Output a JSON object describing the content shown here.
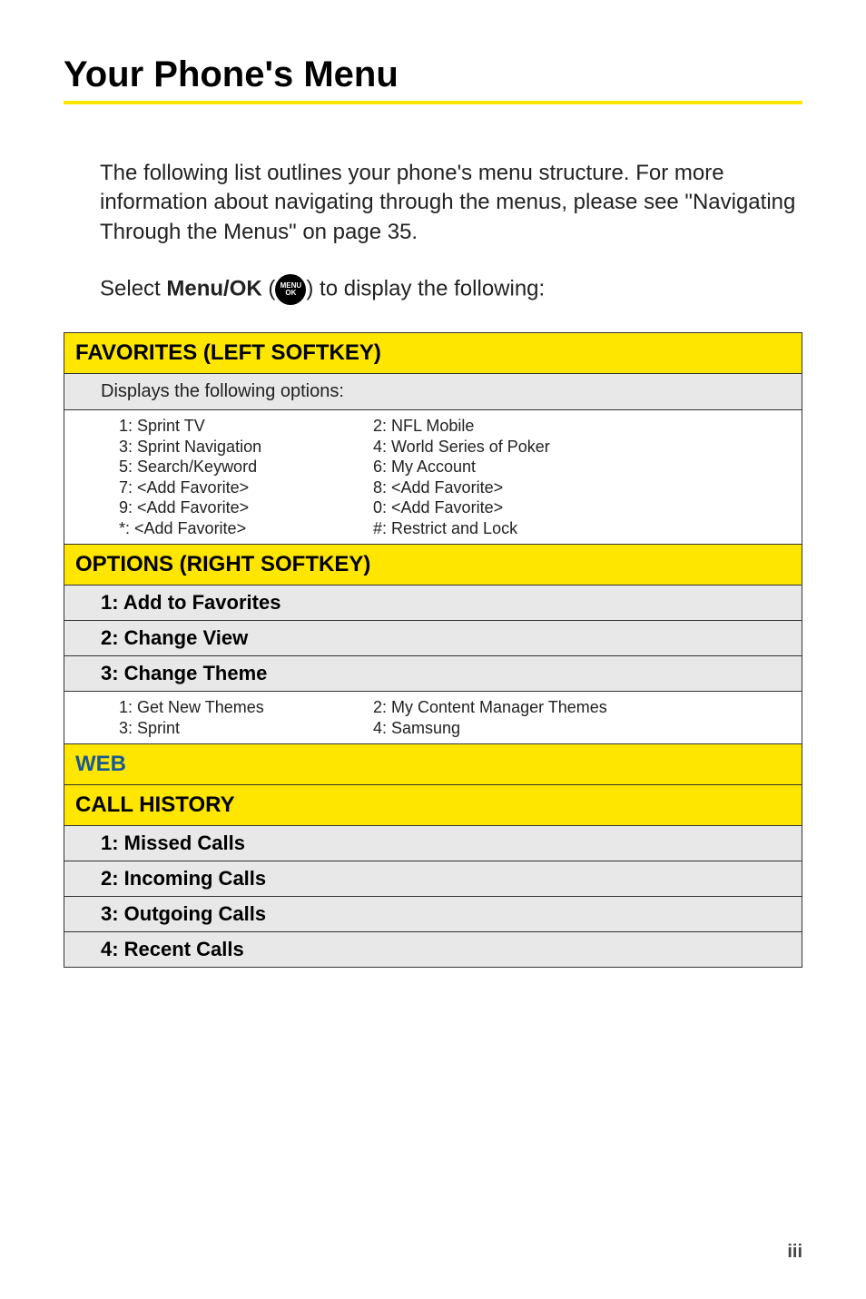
{
  "title": "Your Phone's Menu",
  "intro": "The following list outlines your phone's menu structure. For more information about navigating through the menus, please see \"Navigating Through the Menus\" on page 35.",
  "select_prefix": "Select ",
  "select_bold": "Menu/OK",
  "select_paren_open": " (",
  "icon_top": "MENU",
  "icon_bottom": "OK",
  "select_paren_close": ") ",
  "select_suffix": "to display the following:",
  "sections": {
    "favorites": {
      "header": "FAVORITES (LEFT SOFTKEY)",
      "desc": "Displays the following options:",
      "col1": [
        "1: Sprint TV",
        "3: Sprint Navigation",
        "5: Search/Keyword",
        "7: <Add Favorite>",
        "9: <Add Favorite>",
        "*: <Add Favorite>"
      ],
      "col2": [
        "2: NFL Mobile",
        "4: World Series of Poker",
        "6: My Account",
        "8: <Add Favorite>",
        "0: <Add Favorite>",
        "#: Restrict and Lock"
      ]
    },
    "options": {
      "header": "OPTIONS (RIGHT SOFTKEY)",
      "items": [
        "1: Add to Favorites",
        "2: Change View",
        "3: Change Theme"
      ],
      "themes_col1": [
        "1: Get New Themes",
        "3: Sprint"
      ],
      "themes_col2": [
        "2: My Content Manager Themes",
        "4: Samsung"
      ]
    },
    "web": {
      "header": "WEB"
    },
    "callhistory": {
      "header": "CALL HISTORY",
      "items": [
        "1: Missed Calls",
        "2: Incoming Calls",
        "3: Outgoing Calls",
        "4: Recent Calls"
      ]
    }
  },
  "page_number": "iii"
}
